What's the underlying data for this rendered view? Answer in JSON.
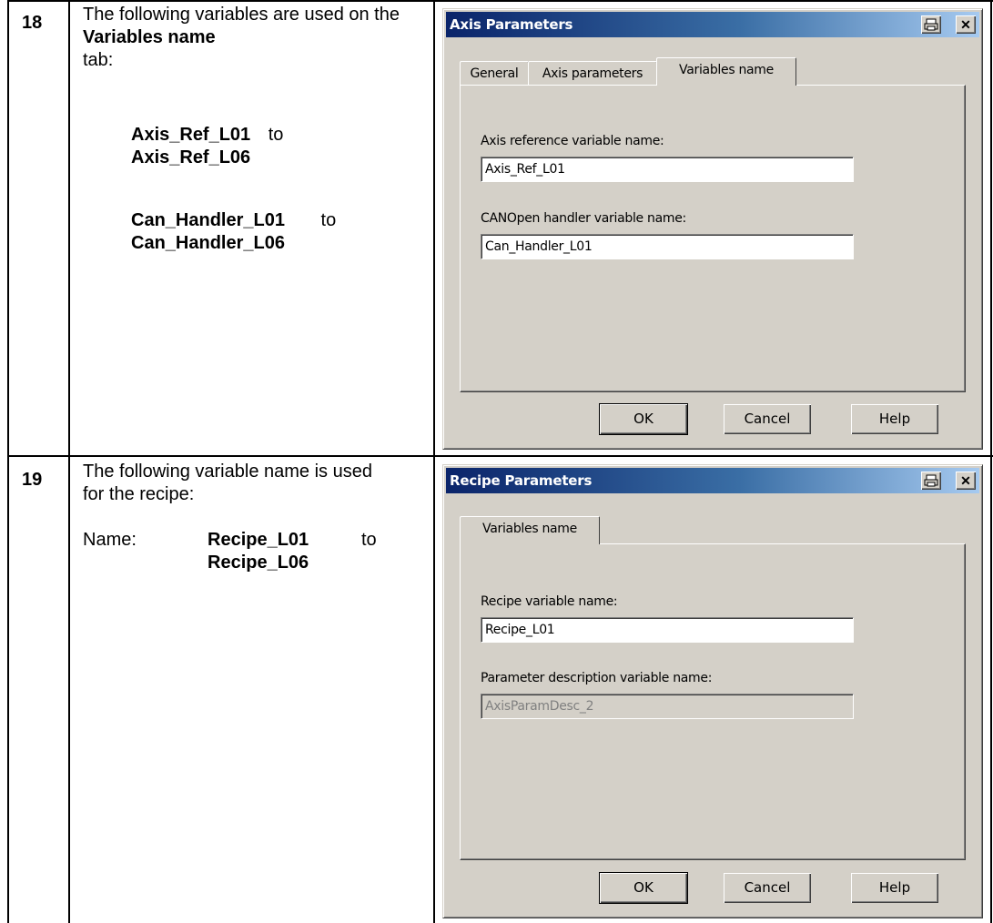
{
  "steps": [
    {
      "number": "18",
      "intro": "The following variables are used on the",
      "intro_bold": "Variables name",
      "intro_end": "tab:",
      "range1_from": "Axis_Ref_L01",
      "range1_to_word": "to",
      "range1_to": "Axis_Ref_L06",
      "range2_from": "Can_Handler_L01",
      "range2_to_word": "to",
      "range2_to": "Can_Handler_L06"
    },
    {
      "number": "19",
      "intro": "The following variable name is used for the recipe:",
      "name_label": "Name:",
      "range_from": "Recipe_L01",
      "range_to_word": "to",
      "range_to": "Recipe_L06"
    }
  ],
  "dialog_axis": {
    "title": "Axis Parameters",
    "tabs": [
      "General",
      "Axis parameters",
      "Variables name"
    ],
    "active_tab": "Variables name",
    "fields": [
      {
        "label": "Axis reference variable name:",
        "value": "Axis_Ref_L01"
      },
      {
        "label": "CANOpen handler variable name:",
        "value": "Can_Handler_L01"
      }
    ],
    "buttons": [
      "OK",
      "Cancel",
      "Help"
    ]
  },
  "dialog_recipe": {
    "title": "Recipe Parameters",
    "tabs": [
      "Variables name"
    ],
    "active_tab": "Variables name",
    "fields": [
      {
        "label": "Recipe variable name:",
        "value": "Recipe_L01",
        "disabled": false
      },
      {
        "label": "Parameter description variable name:",
        "value": "AxisParamDesc_2",
        "disabled": true
      }
    ],
    "buttons": [
      "OK",
      "Cancel",
      "Help"
    ]
  },
  "icons": {
    "print": "printer-icon",
    "close": "close-icon"
  },
  "colors": {
    "dialog_face": "#d4d0c8",
    "title_start": "#0a246a",
    "title_end": "#a6caf0"
  }
}
